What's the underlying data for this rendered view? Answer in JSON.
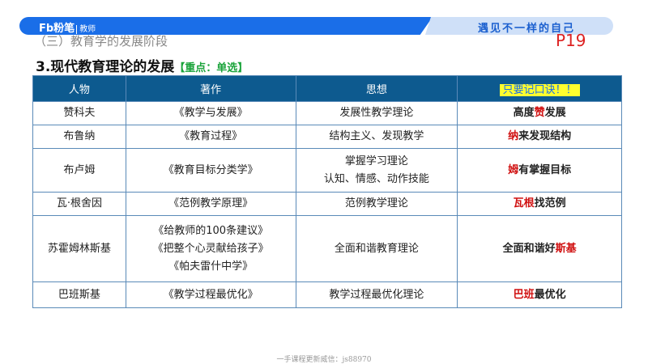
{
  "header": {
    "logo": "Fb粉笔",
    "logo_sub": "教师",
    "slogan": "遇见不一样的自己",
    "section": "（三）教育学的发展阶段",
    "page": "P19"
  },
  "title": {
    "text": "3.现代教育理论的发展",
    "tag": "【重点：单选】"
  },
  "table": {
    "headers": [
      "人物",
      "著作",
      "思想",
      "只要记口诀！！"
    ],
    "rows": [
      {
        "person": "赞科夫",
        "works": [
          "《教学与发展》"
        ],
        "idea": [
          "发展性教学理论"
        ],
        "mnemonic": [
          {
            "t": "高度",
            "r": false
          },
          {
            "t": "赞",
            "r": true
          },
          {
            "t": "发展",
            "r": false
          }
        ]
      },
      {
        "person": "布鲁纳",
        "works": [
          "《教育过程》"
        ],
        "idea": [
          "结构主义、发现教学"
        ],
        "mnemonic": [
          {
            "t": "纳",
            "r": true
          },
          {
            "t": "来发现结构",
            "r": false
          }
        ]
      },
      {
        "person": "布卢姆",
        "works": [
          "《教育目标分类学》"
        ],
        "idea": [
          "掌握学习理论",
          "认知、情感、动作技能"
        ],
        "mnemonic": [
          {
            "t": "姆",
            "r": true
          },
          {
            "t": "有掌握目标",
            "r": false
          }
        ]
      },
      {
        "person": "瓦·根舍因",
        "works": [
          "《范例教学原理》"
        ],
        "idea": [
          "范例教学理论"
        ],
        "mnemonic": [
          {
            "t": "瓦根",
            "r": true
          },
          {
            "t": "找范例",
            "r": false
          }
        ]
      },
      {
        "person": "苏霍姆林斯基",
        "works": [
          "《给教师的100条建议》",
          "《把整个心灵献给孩子》",
          "《帕夫雷什中学》"
        ],
        "idea": [
          "全面和谐教育理论"
        ],
        "mnemonic": [
          {
            "t": "全面和谐好",
            "r": false
          },
          {
            "t": "斯基",
            "r": true
          }
        ]
      },
      {
        "person": "巴班斯基",
        "works": [
          "《教学过程最优化》"
        ],
        "idea": [
          "教学过程最优化理论"
        ],
        "mnemonic": [
          {
            "t": "巴班",
            "r": true
          },
          {
            "t": "最优化",
            "r": false
          }
        ]
      }
    ]
  },
  "footer": "一手课程更新威信：js88970"
}
